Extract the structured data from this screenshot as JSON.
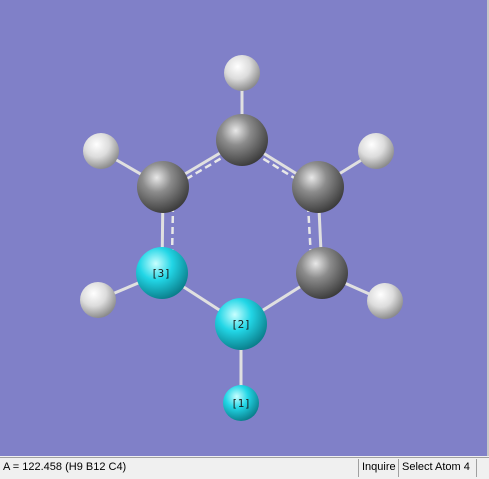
{
  "viewer": {
    "background": "#8080c8",
    "atom_labels": [
      "[1]",
      "[2]",
      "[3]"
    ],
    "atom_colors": {
      "carbon": "#8c8c8c",
      "hydrogen": "#e6e6e6",
      "boron": "#22d6e6"
    }
  },
  "statusbar": {
    "measurement": "A = 122.458 (H9 B12 C4)",
    "mode": "Inquire",
    "prompt": "Select Atom 4"
  }
}
